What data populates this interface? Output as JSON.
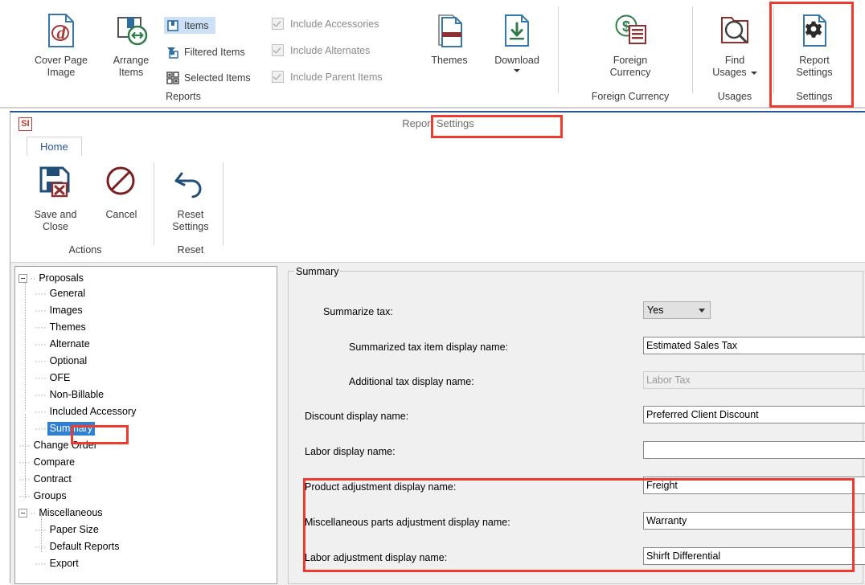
{
  "outer_ribbon": {
    "buttons": [
      {
        "name": "cover-page-image",
        "label_line1": "Cover Page",
        "label_line2": "Image",
        "icon": "page-at-icon"
      },
      {
        "name": "arrange-items",
        "label_line1": "Arrange",
        "label_line2": "Items",
        "icon": "arrange-items-icon"
      },
      {
        "name": "themes",
        "label_line1": "Themes",
        "label_line2": "",
        "icon": "themes-page-icon"
      },
      {
        "name": "download",
        "label_line1": "Download",
        "label_line2": "",
        "icon": "download-page-icon",
        "has_dropdown": true
      },
      {
        "name": "foreign-currency",
        "label_line1": "Foreign",
        "label_line2": "Currency",
        "icon": "dollar-list-icon"
      },
      {
        "name": "find-usages",
        "label_line1": "Find",
        "label_line2": "Usages",
        "icon": "magnifier-folder-icon",
        "has_dropdown": true
      },
      {
        "name": "report-settings",
        "label_line1": "Report",
        "label_line2": "Settings",
        "icon": "gear-page-icon",
        "highlighted": true
      }
    ],
    "small_buttons": [
      {
        "name": "items",
        "label": "Items",
        "icon": "items-box-icon",
        "selected": true
      },
      {
        "name": "filtered-items",
        "label": "Filtered Items",
        "icon": "funnel-box-icon",
        "selected": false
      },
      {
        "name": "selected-items",
        "label": "Selected Items",
        "icon": "grid-select-icon",
        "selected": false
      }
    ],
    "checkboxes": [
      {
        "name": "include-accessories",
        "label": "Include Accessories",
        "checked": true,
        "disabled": true
      },
      {
        "name": "include-alternates",
        "label": "Include Alternates",
        "checked": true,
        "disabled": true
      },
      {
        "name": "include-parent-items",
        "label": "Include Parent Items",
        "checked": true,
        "disabled": true
      }
    ],
    "group_labels": [
      {
        "name": "group-reports",
        "label": "Reports"
      },
      {
        "name": "group-foreign-currency",
        "label": "Foreign Currency"
      },
      {
        "name": "group-usages",
        "label": "Usages"
      },
      {
        "name": "group-settings",
        "label": "Settings"
      }
    ]
  },
  "inner_window": {
    "logo_text": "SI",
    "title": "Report Settings",
    "tab": "Home",
    "ribbon": {
      "buttons": [
        {
          "name": "save-and-close",
          "label_line1": "Save and",
          "label_line2": "Close",
          "icon": "save-close-icon"
        },
        {
          "name": "cancel",
          "label_line1": "Cancel",
          "label_line2": "",
          "icon": "cancel-circle-icon"
        },
        {
          "name": "reset-settings",
          "label_line1": "Reset",
          "label_line2": "Settings",
          "icon": "undo-arrow-icon"
        }
      ],
      "group_labels": [
        {
          "name": "group-actions",
          "label": "Actions"
        },
        {
          "name": "group-reset",
          "label": "Reset"
        }
      ]
    }
  },
  "tree": {
    "nodes": [
      {
        "label": "Proposals",
        "level": 0,
        "expandable": true,
        "selected": false
      },
      {
        "label": "General",
        "level": 1,
        "expandable": false,
        "selected": false
      },
      {
        "label": "Images",
        "level": 1,
        "expandable": false,
        "selected": false
      },
      {
        "label": "Themes",
        "level": 1,
        "expandable": false,
        "selected": false
      },
      {
        "label": "Alternate",
        "level": 1,
        "expandable": false,
        "selected": false
      },
      {
        "label": "Optional",
        "level": 1,
        "expandable": false,
        "selected": false
      },
      {
        "label": "OFE",
        "level": 1,
        "expandable": false,
        "selected": false
      },
      {
        "label": "Non-Billable",
        "level": 1,
        "expandable": false,
        "selected": false
      },
      {
        "label": "Included Accessory",
        "level": 1,
        "expandable": false,
        "selected": false
      },
      {
        "label": "Summary",
        "level": 1,
        "expandable": false,
        "selected": true
      },
      {
        "label": "Change Order",
        "level": 0,
        "expandable": false,
        "selected": false
      },
      {
        "label": "Compare",
        "level": 0,
        "expandable": false,
        "selected": false
      },
      {
        "label": "Contract",
        "level": 0,
        "expandable": false,
        "selected": false
      },
      {
        "label": "Groups",
        "level": 0,
        "expandable": false,
        "selected": false
      },
      {
        "label": "Miscellaneous",
        "level": 0,
        "expandable": true,
        "selected": false
      },
      {
        "label": "Paper Size",
        "level": 1,
        "expandable": false,
        "selected": false
      },
      {
        "label": "Default Reports",
        "level": 1,
        "expandable": false,
        "selected": false
      },
      {
        "label": "Export",
        "level": 1,
        "expandable": false,
        "selected": false
      }
    ]
  },
  "form": {
    "group_title": "Summary",
    "rows": [
      {
        "name": "summarize-tax",
        "label": "Summarize tax:",
        "control": "combo",
        "value": "Yes",
        "indent": 0,
        "disabled": false
      },
      {
        "name": "summarized-tax-item-display-name",
        "label": "Summarized tax item display name:",
        "control": "text",
        "value": "Estimated Sales Tax",
        "indent": 1,
        "disabled": false
      },
      {
        "name": "additional-tax-display-name",
        "label": "Additional tax display name:",
        "control": "text",
        "value": "Labor Tax",
        "indent": 1,
        "disabled": true
      },
      {
        "name": "discount-display-name",
        "label": "Discount display name:",
        "control": "text",
        "value": "Preferred Client Discount",
        "indent": 0,
        "disabled": false
      },
      {
        "name": "labor-display-name",
        "label": "Labor display name:",
        "control": "text",
        "value": "",
        "indent": 0,
        "disabled": false
      },
      {
        "name": "product-adjustment-display-name",
        "label": "Product adjustment display name:",
        "control": "text",
        "value": "Freight",
        "indent": 0,
        "disabled": false
      },
      {
        "name": "miscellaneous-parts-adjustment-display-name",
        "label": "Miscellaneous parts adjustment display name:",
        "control": "text",
        "value": "Warranty",
        "indent": 0,
        "disabled": false
      },
      {
        "name": "labor-adjustment-display-name",
        "label": "Labor adjustment display name:",
        "control": "text",
        "value": "Shirft Differential",
        "indent": 0,
        "disabled": false
      }
    ]
  },
  "annotations": {
    "highlight_color": "#ef3b2d",
    "boxes": [
      {
        "name": "report-settings-button-highlight"
      },
      {
        "name": "report-settings-title-highlight"
      },
      {
        "name": "summary-tree-node-highlight"
      },
      {
        "name": "adjustment-fields-highlight"
      }
    ]
  },
  "colors": {
    "accent_blue": "#2b579a",
    "selection_blue": "#2f7fd4",
    "ribbon_selection": "#cce1f5",
    "panel_gray": "#f0f0f0",
    "annotation_red": "#ef3b2d"
  }
}
